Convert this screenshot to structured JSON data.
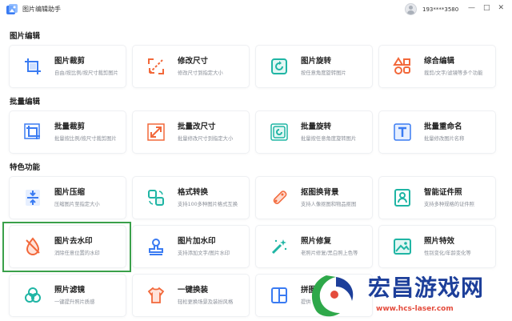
{
  "app": {
    "title": "图片编辑助手",
    "phone": "193****3580",
    "controls": {
      "minimize": "—",
      "restore": "□",
      "close": "✕"
    }
  },
  "sections": [
    {
      "title": "图片编辑"
    },
    {
      "title": "批量编辑"
    },
    {
      "title": "特色功能"
    }
  ],
  "cards": [
    {
      "title": "图片裁剪",
      "desc": "自由/按比例/按尺寸裁剪图片",
      "icon": "crop-icon"
    },
    {
      "title": "修改尺寸",
      "desc": "修改尺寸到指定大小",
      "icon": "resize-icon"
    },
    {
      "title": "图片旋转",
      "desc": "按任意角度旋转图片",
      "icon": "rotate-icon"
    },
    {
      "title": "综合编辑",
      "desc": "裁剪/文字/滤镜等多个功能",
      "icon": "shapes-icon"
    },
    {
      "title": "批量裁剪",
      "desc": "批量按比例/按尺寸裁剪图片",
      "icon": "batch-crop-icon"
    },
    {
      "title": "批量改尺寸",
      "desc": "批量修改尺寸到指定大小",
      "icon": "batch-resize-icon"
    },
    {
      "title": "批量旋转",
      "desc": "批量按任意角度旋转图片",
      "icon": "batch-rotate-icon"
    },
    {
      "title": "批量重命名",
      "desc": "批量修改图片名称",
      "icon": "rename-icon"
    },
    {
      "title": "图片压缩",
      "desc": "压缩图片至指定大小",
      "icon": "compress-icon"
    },
    {
      "title": "格式转换",
      "desc": "支持100多种图片格式互换",
      "icon": "convert-icon"
    },
    {
      "title": "抠图换背景",
      "desc": "支持人像抠图和物品抠图",
      "icon": "cutout-icon"
    },
    {
      "title": "智能证件照",
      "desc": "支持多种规格的证件照",
      "icon": "id-photo-icon"
    },
    {
      "title": "图片去水印",
      "desc": "消除任意位置的水印",
      "icon": "remove-watermark-icon"
    },
    {
      "title": "图片加水印",
      "desc": "支持添加文字/图片水印",
      "icon": "add-watermark-icon"
    },
    {
      "title": "照片修复",
      "desc": "老照片修复/黑白照上色等",
      "icon": "magic-wand-icon"
    },
    {
      "title": "照片特效",
      "desc": "性别变化/年龄变化等",
      "icon": "photo-effect-icon"
    },
    {
      "title": "照片滤镜",
      "desc": "一键提升照片质感",
      "icon": "filter-icon"
    },
    {
      "title": "一键换装",
      "desc": "轻松更换场景及装扮风格",
      "icon": "outfit-icon"
    },
    {
      "title": "拼图",
      "desc": "提供",
      "icon": "collage-icon"
    }
  ],
  "watermark": {
    "text": "宏昌游戏网",
    "url": "www.hcs-laser.com"
  },
  "colors": {
    "primary": "#3a7bf2",
    "accent": "#f2683a",
    "teal": "#1fb5a4",
    "highlight": "#3aa04a"
  }
}
